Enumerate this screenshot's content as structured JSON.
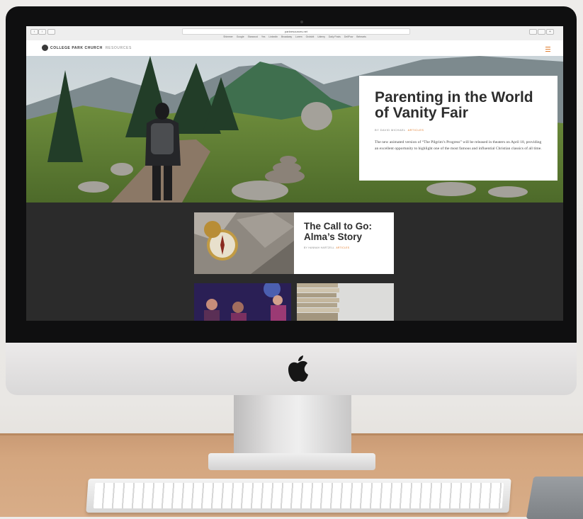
{
  "browser": {
    "url": "parkresources.net",
    "bookmarks": [
      "Shimmer",
      "Google",
      "Starwood",
      "Yes",
      "Linkedin",
      "Broadway",
      "Lorem",
      "Grolsbit",
      "Udemy",
      "Daily Posts",
      "DeliPow",
      "Behearts"
    ]
  },
  "site": {
    "name": "COLLEGE PARK CHURCH",
    "section": "RESOURCES"
  },
  "hero": {
    "title": "Parenting in the World of Vanity Fair",
    "byline": "BY DAVID MICHAEL",
    "category": "ARTICLES",
    "excerpt": "The new animated version of “The Pilgrim’s Progress” will be released in theaters on April 18, providing an excellent opportunity to highlight one of the most famous and influential Christian classics of all time."
  },
  "cards": [
    {
      "title": "The Call to Go: Alma’s Story",
      "byline": "BY HANNAH HARTZELL",
      "category": "ARTICLES"
    }
  ],
  "colors": {
    "accent": "#e07b2c",
    "screen_background": "#2b2b2b"
  }
}
